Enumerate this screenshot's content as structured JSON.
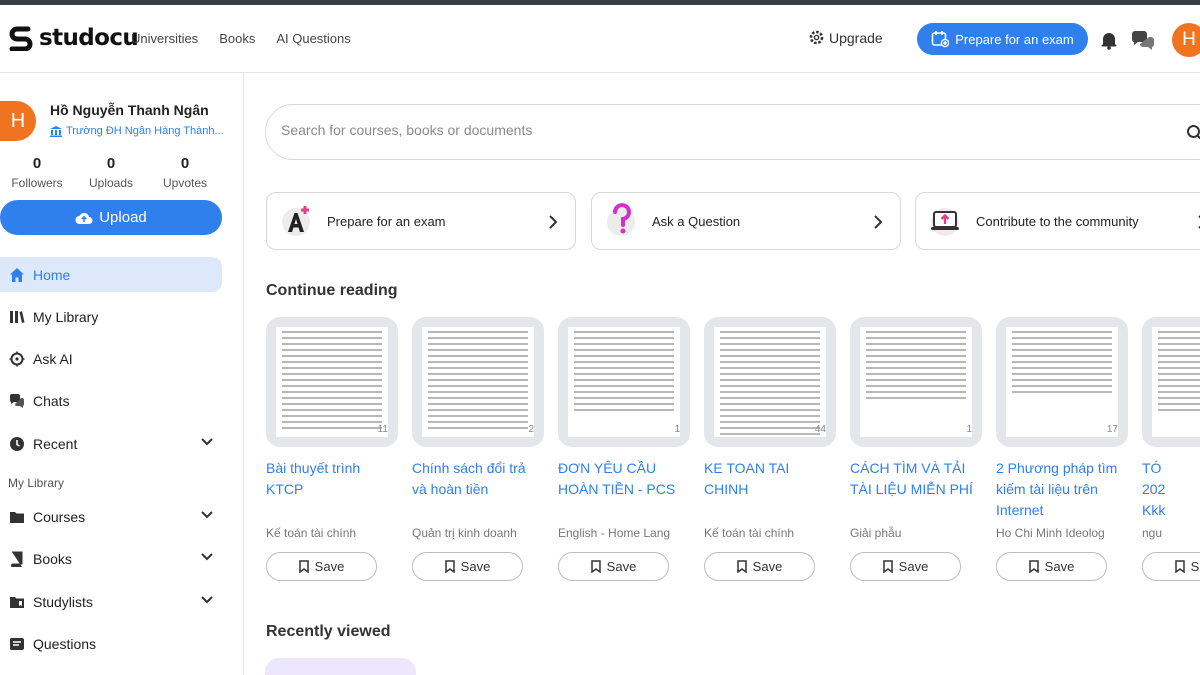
{
  "brand": {
    "name": "studocu"
  },
  "nav": [
    "Universities",
    "Books",
    "AI Questions"
  ],
  "header": {
    "upgrade": "Upgrade",
    "prepare": "Prepare for an exam",
    "avatar_initial": "H"
  },
  "profile": {
    "initial": "H",
    "name": "Hồ Nguyễn Thanh Ngân",
    "university": "Trường ĐH Ngân Hàng Thành...",
    "stats": [
      {
        "value": "0",
        "label": "Followers"
      },
      {
        "value": "0",
        "label": "Uploads"
      },
      {
        "value": "0",
        "label": "Upvotes"
      }
    ],
    "upload": "Upload"
  },
  "sidebar": {
    "items": [
      {
        "label": "Home",
        "icon": "home-icon"
      },
      {
        "label": "My Library",
        "icon": "library-icon"
      },
      {
        "label": "Ask AI",
        "icon": "ai-icon"
      },
      {
        "label": "Chats",
        "icon": "chat-icon"
      },
      {
        "label": "Recent",
        "icon": "clock-icon"
      }
    ],
    "section": "My Library",
    "library_items": [
      {
        "label": "Courses",
        "icon": "folder-icon"
      },
      {
        "label": "Books",
        "icon": "book-icon"
      },
      {
        "label": "Studylists",
        "icon": "studylist-icon"
      },
      {
        "label": "Questions",
        "icon": "questions-icon"
      }
    ]
  },
  "search": {
    "placeholder": "Search for courses, books or documents"
  },
  "actions": [
    "Prepare for an exam",
    "Ask a Question",
    "Contribute to the community"
  ],
  "continue_heading": "Continue reading",
  "documents": [
    {
      "title": "Bài thuyết trình KTCP",
      "course": "Kế toán tài chính",
      "pages": "11"
    },
    {
      "title": "Chính sách đổi trả và hoàn tiền",
      "course": "Quản trị kinh doanh",
      "pages": "2"
    },
    {
      "title": "ĐƠN YÊU CẦU HOÀN TIỀN - PCS",
      "course": "English - Home Lang",
      "pages": "1"
    },
    {
      "title": "KE TOAN TAI CHINH",
      "course": "Kế toán tài chính",
      "pages": "44"
    },
    {
      "title": "CÁCH TÌM VÀ TẢI TÀI LIỆU MIỄN PHÍ",
      "course": "Giải phẫu",
      "pages": "1"
    },
    {
      "title": "2 Phương pháp tìm kiếm tài liệu trên Internet",
      "course": "Ho Chi Minh Ideolog",
      "pages": "17"
    },
    {
      "title": "TÓ 202 Kkk",
      "course": "ngu",
      "pages": ""
    }
  ],
  "save_label": "Save",
  "recent_heading": "Recently viewed",
  "colors": {
    "accent": "#2f80ed",
    "avatar": "#f0731f",
    "active_bg": "#dde9fb"
  }
}
